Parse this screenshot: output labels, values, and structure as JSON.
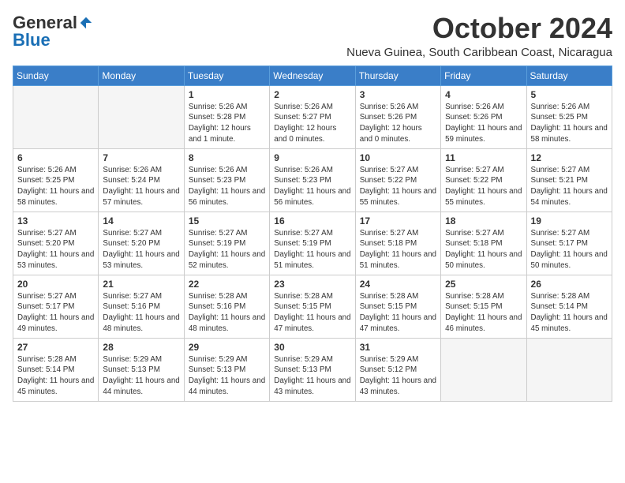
{
  "header": {
    "logo_general": "General",
    "logo_blue": "Blue",
    "month_title": "October 2024",
    "location": "Nueva Guinea, South Caribbean Coast, Nicaragua"
  },
  "weekdays": [
    "Sunday",
    "Monday",
    "Tuesday",
    "Wednesday",
    "Thursday",
    "Friday",
    "Saturday"
  ],
  "weeks": [
    [
      {
        "day": "",
        "info": ""
      },
      {
        "day": "",
        "info": ""
      },
      {
        "day": "1",
        "info": "Sunrise: 5:26 AM\nSunset: 5:28 PM\nDaylight: 12 hours\nand 1 minute."
      },
      {
        "day": "2",
        "info": "Sunrise: 5:26 AM\nSunset: 5:27 PM\nDaylight: 12 hours\nand 0 minutes."
      },
      {
        "day": "3",
        "info": "Sunrise: 5:26 AM\nSunset: 5:26 PM\nDaylight: 12 hours\nand 0 minutes."
      },
      {
        "day": "4",
        "info": "Sunrise: 5:26 AM\nSunset: 5:26 PM\nDaylight: 11 hours\nand 59 minutes."
      },
      {
        "day": "5",
        "info": "Sunrise: 5:26 AM\nSunset: 5:25 PM\nDaylight: 11 hours\nand 58 minutes."
      }
    ],
    [
      {
        "day": "6",
        "info": "Sunrise: 5:26 AM\nSunset: 5:25 PM\nDaylight: 11 hours\nand 58 minutes."
      },
      {
        "day": "7",
        "info": "Sunrise: 5:26 AM\nSunset: 5:24 PM\nDaylight: 11 hours\nand 57 minutes."
      },
      {
        "day": "8",
        "info": "Sunrise: 5:26 AM\nSunset: 5:23 PM\nDaylight: 11 hours\nand 56 minutes."
      },
      {
        "day": "9",
        "info": "Sunrise: 5:26 AM\nSunset: 5:23 PM\nDaylight: 11 hours\nand 56 minutes."
      },
      {
        "day": "10",
        "info": "Sunrise: 5:27 AM\nSunset: 5:22 PM\nDaylight: 11 hours\nand 55 minutes."
      },
      {
        "day": "11",
        "info": "Sunrise: 5:27 AM\nSunset: 5:22 PM\nDaylight: 11 hours\nand 55 minutes."
      },
      {
        "day": "12",
        "info": "Sunrise: 5:27 AM\nSunset: 5:21 PM\nDaylight: 11 hours\nand 54 minutes."
      }
    ],
    [
      {
        "day": "13",
        "info": "Sunrise: 5:27 AM\nSunset: 5:20 PM\nDaylight: 11 hours\nand 53 minutes."
      },
      {
        "day": "14",
        "info": "Sunrise: 5:27 AM\nSunset: 5:20 PM\nDaylight: 11 hours\nand 53 minutes."
      },
      {
        "day": "15",
        "info": "Sunrise: 5:27 AM\nSunset: 5:19 PM\nDaylight: 11 hours\nand 52 minutes."
      },
      {
        "day": "16",
        "info": "Sunrise: 5:27 AM\nSunset: 5:19 PM\nDaylight: 11 hours\nand 51 minutes."
      },
      {
        "day": "17",
        "info": "Sunrise: 5:27 AM\nSunset: 5:18 PM\nDaylight: 11 hours\nand 51 minutes."
      },
      {
        "day": "18",
        "info": "Sunrise: 5:27 AM\nSunset: 5:18 PM\nDaylight: 11 hours\nand 50 minutes."
      },
      {
        "day": "19",
        "info": "Sunrise: 5:27 AM\nSunset: 5:17 PM\nDaylight: 11 hours\nand 50 minutes."
      }
    ],
    [
      {
        "day": "20",
        "info": "Sunrise: 5:27 AM\nSunset: 5:17 PM\nDaylight: 11 hours\nand 49 minutes."
      },
      {
        "day": "21",
        "info": "Sunrise: 5:27 AM\nSunset: 5:16 PM\nDaylight: 11 hours\nand 48 minutes."
      },
      {
        "day": "22",
        "info": "Sunrise: 5:28 AM\nSunset: 5:16 PM\nDaylight: 11 hours\nand 48 minutes."
      },
      {
        "day": "23",
        "info": "Sunrise: 5:28 AM\nSunset: 5:15 PM\nDaylight: 11 hours\nand 47 minutes."
      },
      {
        "day": "24",
        "info": "Sunrise: 5:28 AM\nSunset: 5:15 PM\nDaylight: 11 hours\nand 47 minutes."
      },
      {
        "day": "25",
        "info": "Sunrise: 5:28 AM\nSunset: 5:15 PM\nDaylight: 11 hours\nand 46 minutes."
      },
      {
        "day": "26",
        "info": "Sunrise: 5:28 AM\nSunset: 5:14 PM\nDaylight: 11 hours\nand 45 minutes."
      }
    ],
    [
      {
        "day": "27",
        "info": "Sunrise: 5:28 AM\nSunset: 5:14 PM\nDaylight: 11 hours\nand 45 minutes."
      },
      {
        "day": "28",
        "info": "Sunrise: 5:29 AM\nSunset: 5:13 PM\nDaylight: 11 hours\nand 44 minutes."
      },
      {
        "day": "29",
        "info": "Sunrise: 5:29 AM\nSunset: 5:13 PM\nDaylight: 11 hours\nand 44 minutes."
      },
      {
        "day": "30",
        "info": "Sunrise: 5:29 AM\nSunset: 5:13 PM\nDaylight: 11 hours\nand 43 minutes."
      },
      {
        "day": "31",
        "info": "Sunrise: 5:29 AM\nSunset: 5:12 PM\nDaylight: 11 hours\nand 43 minutes."
      },
      {
        "day": "",
        "info": ""
      },
      {
        "day": "",
        "info": ""
      }
    ]
  ]
}
